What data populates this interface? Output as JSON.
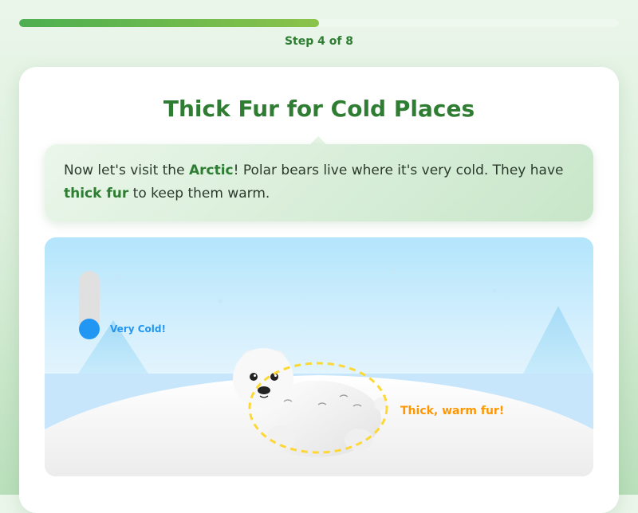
{
  "progress": {
    "step_text": "Step 4 of 8",
    "fraction": 0.5
  },
  "lesson": {
    "title": "Thick Fur for Cold Places",
    "message": {
      "part1": "Now let's visit the ",
      "highlight1": "Arctic",
      "part2": "! Polar bears live where it's very cold. They have ",
      "highlight2": "thick fur",
      "part3": " to keep them warm."
    }
  },
  "scene": {
    "thermometer_label": "Very Cold!",
    "fur_callout": "Thick, warm fur!"
  },
  "colors": {
    "accent": "#2e7d32",
    "progress_start": "#4caf50",
    "progress_end": "#8bc34a",
    "cold": "#2196f3",
    "callout": "#ff9800",
    "highlight_ring": "#fdd835"
  }
}
